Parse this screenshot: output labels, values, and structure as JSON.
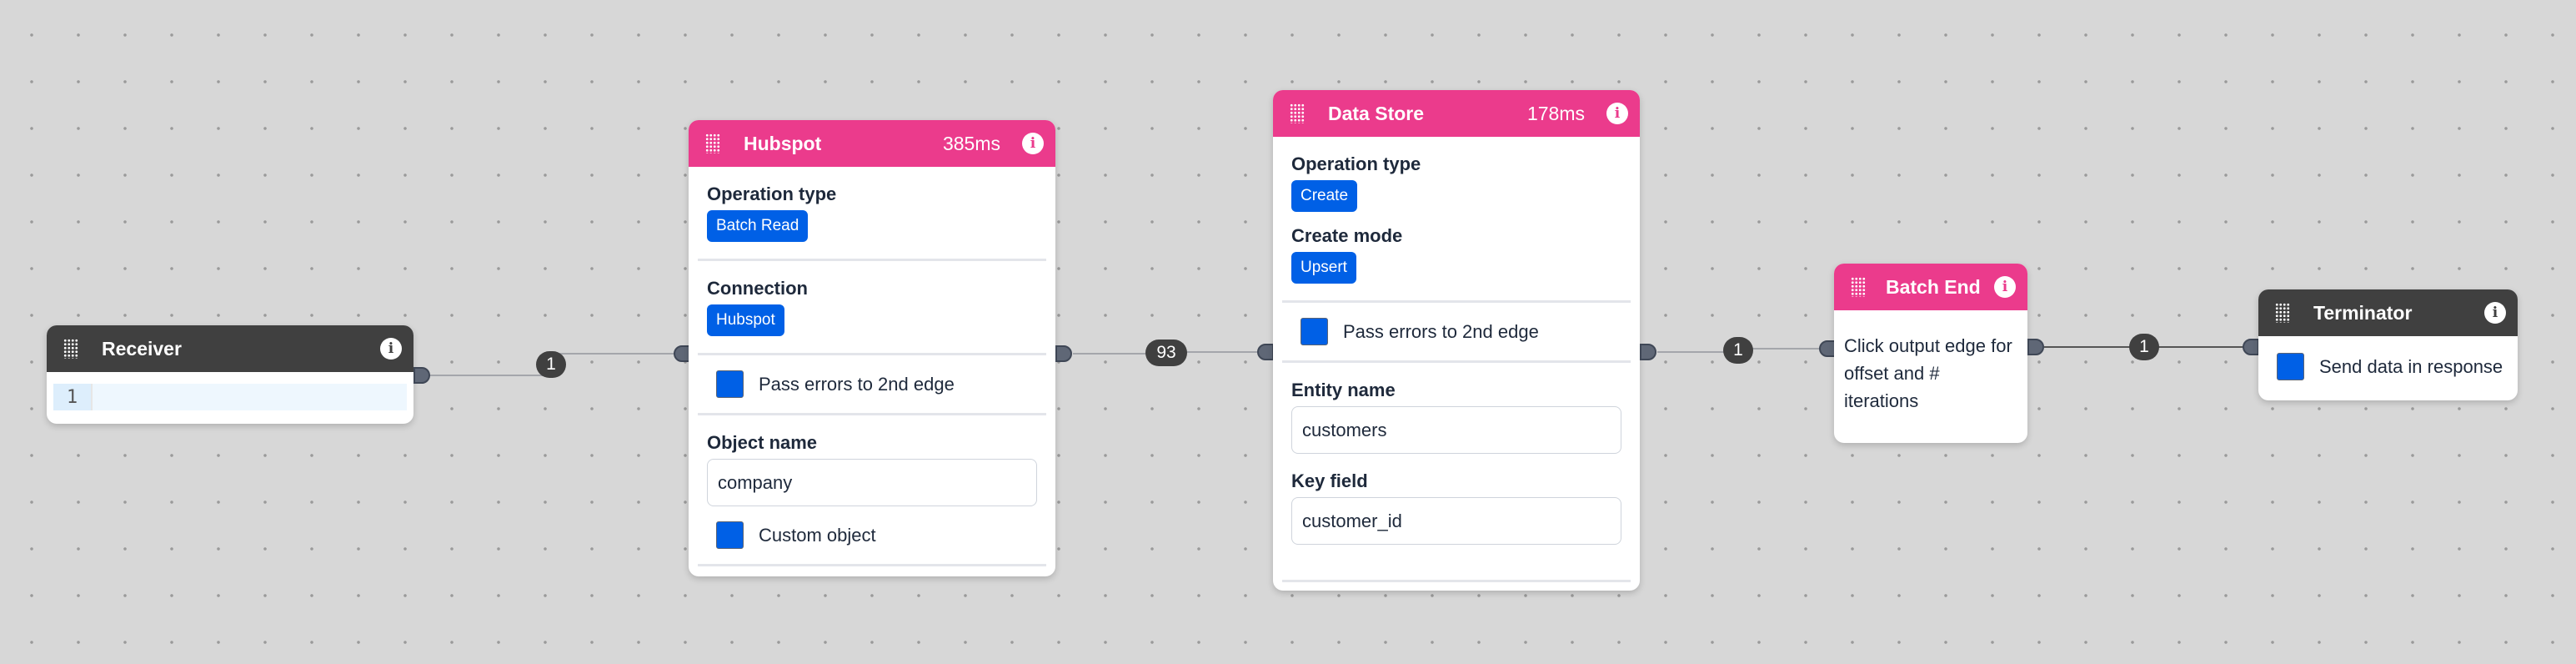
{
  "canvas": {
    "background": "#d7d7d7",
    "edge_badge_color": "#404040",
    "accent_pink": "#eb3b8c",
    "header_dark": "#404040",
    "chip_blue": "#0060e6"
  },
  "nodes": {
    "receiver": {
      "title": "Receiver",
      "editor_line_number": "1",
      "editor_content": ""
    },
    "hubspot": {
      "title": "Hubspot",
      "duration": "385ms",
      "operation_type_label": "Operation type",
      "operation_type_value": "Batch Read",
      "connection_label": "Connection",
      "connection_value": "Hubspot",
      "pass_errors_label": "Pass errors to 2nd edge",
      "object_name_label": "Object name",
      "object_name_value": "company",
      "custom_object_label": "Custom object"
    },
    "data_store": {
      "title": "Data Store",
      "duration": "178ms",
      "operation_type_label": "Operation type",
      "operation_type_value": "Create",
      "create_mode_label": "Create mode",
      "create_mode_value": "Upsert",
      "pass_errors_label": "Pass errors to 2nd edge",
      "entity_name_label": "Entity name",
      "entity_name_value": "customers",
      "key_field_label": "Key field",
      "key_field_value": "customer_id"
    },
    "batch_end": {
      "title": "Batch End",
      "description": "Click output edge for offset and # iterations"
    },
    "terminator": {
      "title": "Terminator",
      "send_data_label": "Send data in response"
    }
  },
  "edges": [
    {
      "from": "Receiver",
      "to": "Hubspot",
      "count": "1"
    },
    {
      "from": "Hubspot",
      "to": "Data Store",
      "count": "93"
    },
    {
      "from": "Data Store",
      "to": "Batch End",
      "count": "1"
    },
    {
      "from": "Batch End",
      "to": "Terminator",
      "count": "1"
    }
  ],
  "icons": {
    "grip": "drag-grip-icon",
    "info": "info-icon",
    "info_glyph": "i"
  }
}
